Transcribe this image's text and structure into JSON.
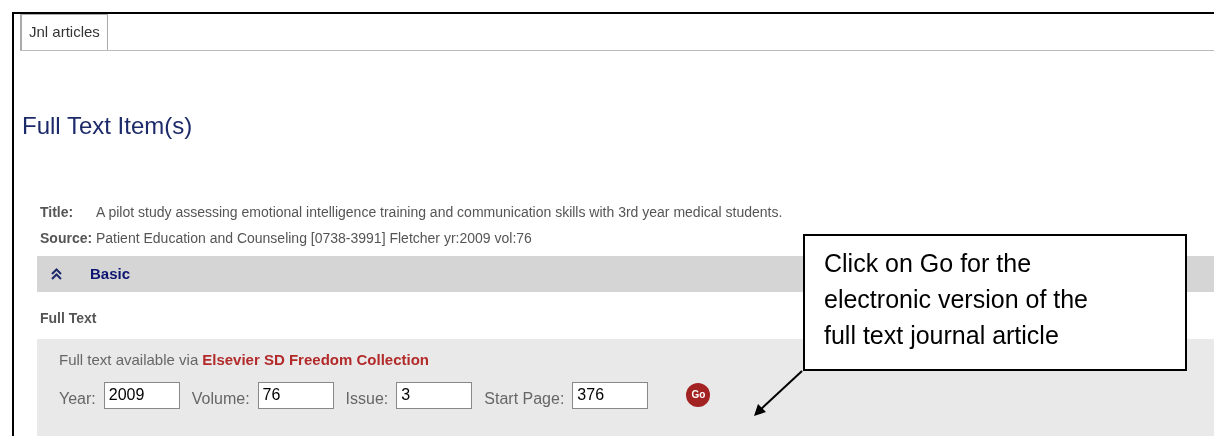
{
  "tabs": [
    {
      "label": "Jnl articles",
      "selected": true
    }
  ],
  "heading": "Full Text Item(s)",
  "details": [
    {
      "label": "Title:",
      "value": "A pilot study assessing emotional intelligence training and communication skills with 3rd year medical students."
    },
    {
      "label": "Source:",
      "value": "Patient Education and Counseling [0738-3991] Fletcher yr:2009 vol:76"
    }
  ],
  "section": {
    "title": "Basic",
    "expanded": true
  },
  "subheading": "Full Text",
  "availability": {
    "text": "Full text available via",
    "link": "Elsevier SD Freedom Collection"
  },
  "fields": [
    {
      "label": "Year:",
      "value": "2009"
    },
    {
      "label": "Volume:",
      "value": "76"
    },
    {
      "label": "Issue:",
      "value": "3"
    },
    {
      "label": "Start Page:",
      "value": "376"
    }
  ],
  "go_button": "Go",
  "callout": [
    "Click on Go for the",
    "electronic version of the",
    "full text journal article"
  ]
}
